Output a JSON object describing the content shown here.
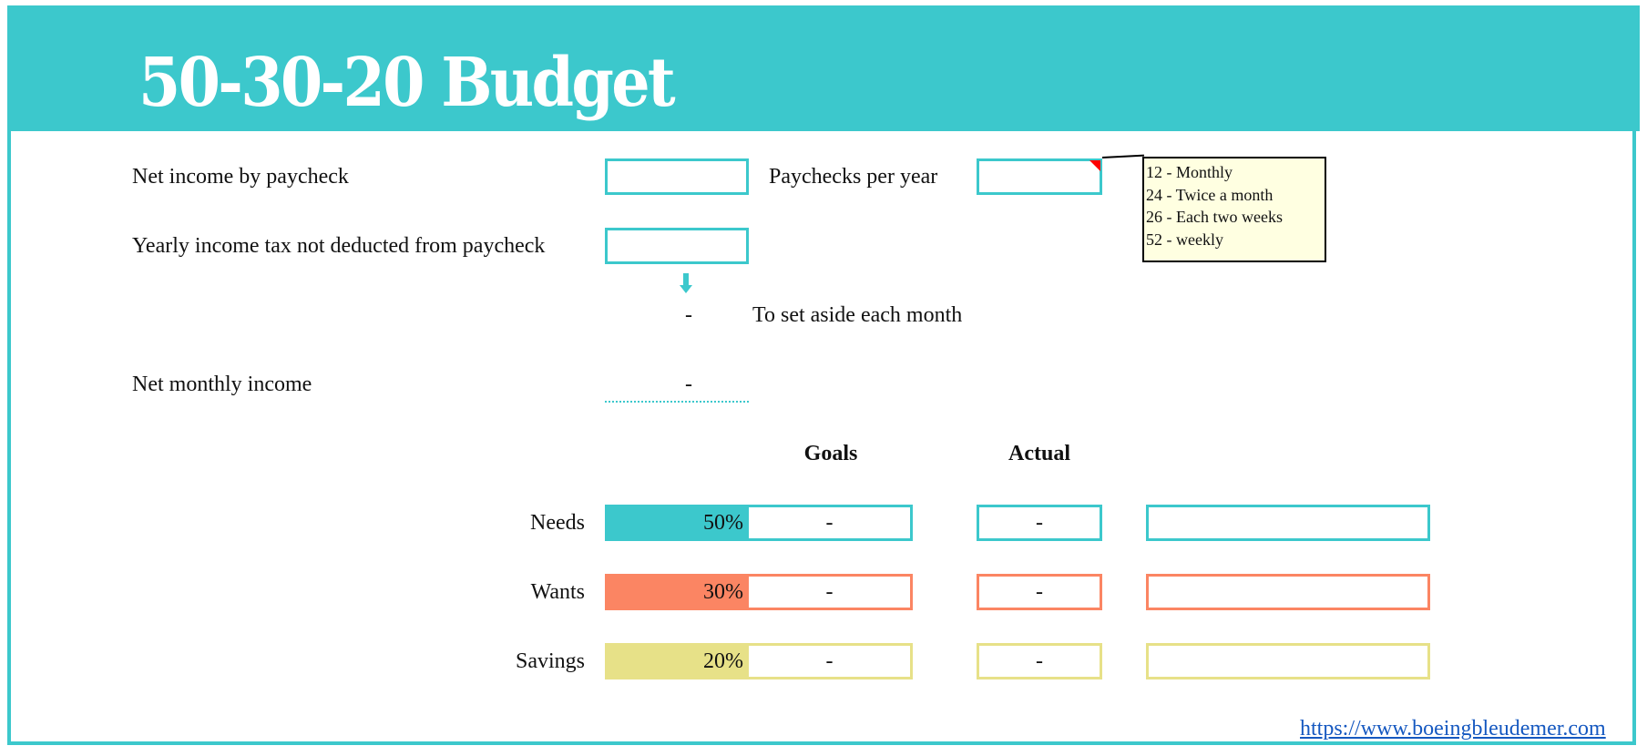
{
  "header": {
    "title": "50-30-20 Budget"
  },
  "colors": {
    "teal": "#3CC8CC",
    "orange": "#FB8563",
    "yellow": "#E7E188",
    "link": "#1558C0",
    "comment_bg": "#FFFFE1",
    "comment_marker": "#FF0000"
  },
  "income": {
    "net_income_label": "Net income by paycheck",
    "net_income_value": "",
    "paychecks_label": "Paychecks per year",
    "paychecks_value": "",
    "yearly_tax_label": "Yearly income tax not deducted from paycheck",
    "yearly_tax_value": "",
    "set_aside_value": "-",
    "set_aside_label": "To set aside each month",
    "net_monthly_label": "Net monthly income",
    "net_monthly_value": "-"
  },
  "paychecks_comment": {
    "lines": [
      "12 - Monthly",
      "24 - Twice a month",
      "26 - Each two weeks",
      "52 - weekly"
    ]
  },
  "table": {
    "headers": {
      "goals": "Goals",
      "actual": "Actual"
    },
    "rows": [
      {
        "label": "Needs",
        "percent": "50%",
        "percent_value": 50,
        "goal": "-",
        "actual": "-",
        "note": "",
        "color": "#3CC8CC"
      },
      {
        "label": "Wants",
        "percent": "30%",
        "percent_value": 30,
        "goal": "-",
        "actual": "-",
        "note": "",
        "color": "#FB8563"
      },
      {
        "label": "Savings",
        "percent": "20%",
        "percent_value": 20,
        "goal": "-",
        "actual": "-",
        "note": "",
        "color": "#E7E188"
      }
    ]
  },
  "footer": {
    "link_text": "https://www.boeingbleudemer.com"
  }
}
